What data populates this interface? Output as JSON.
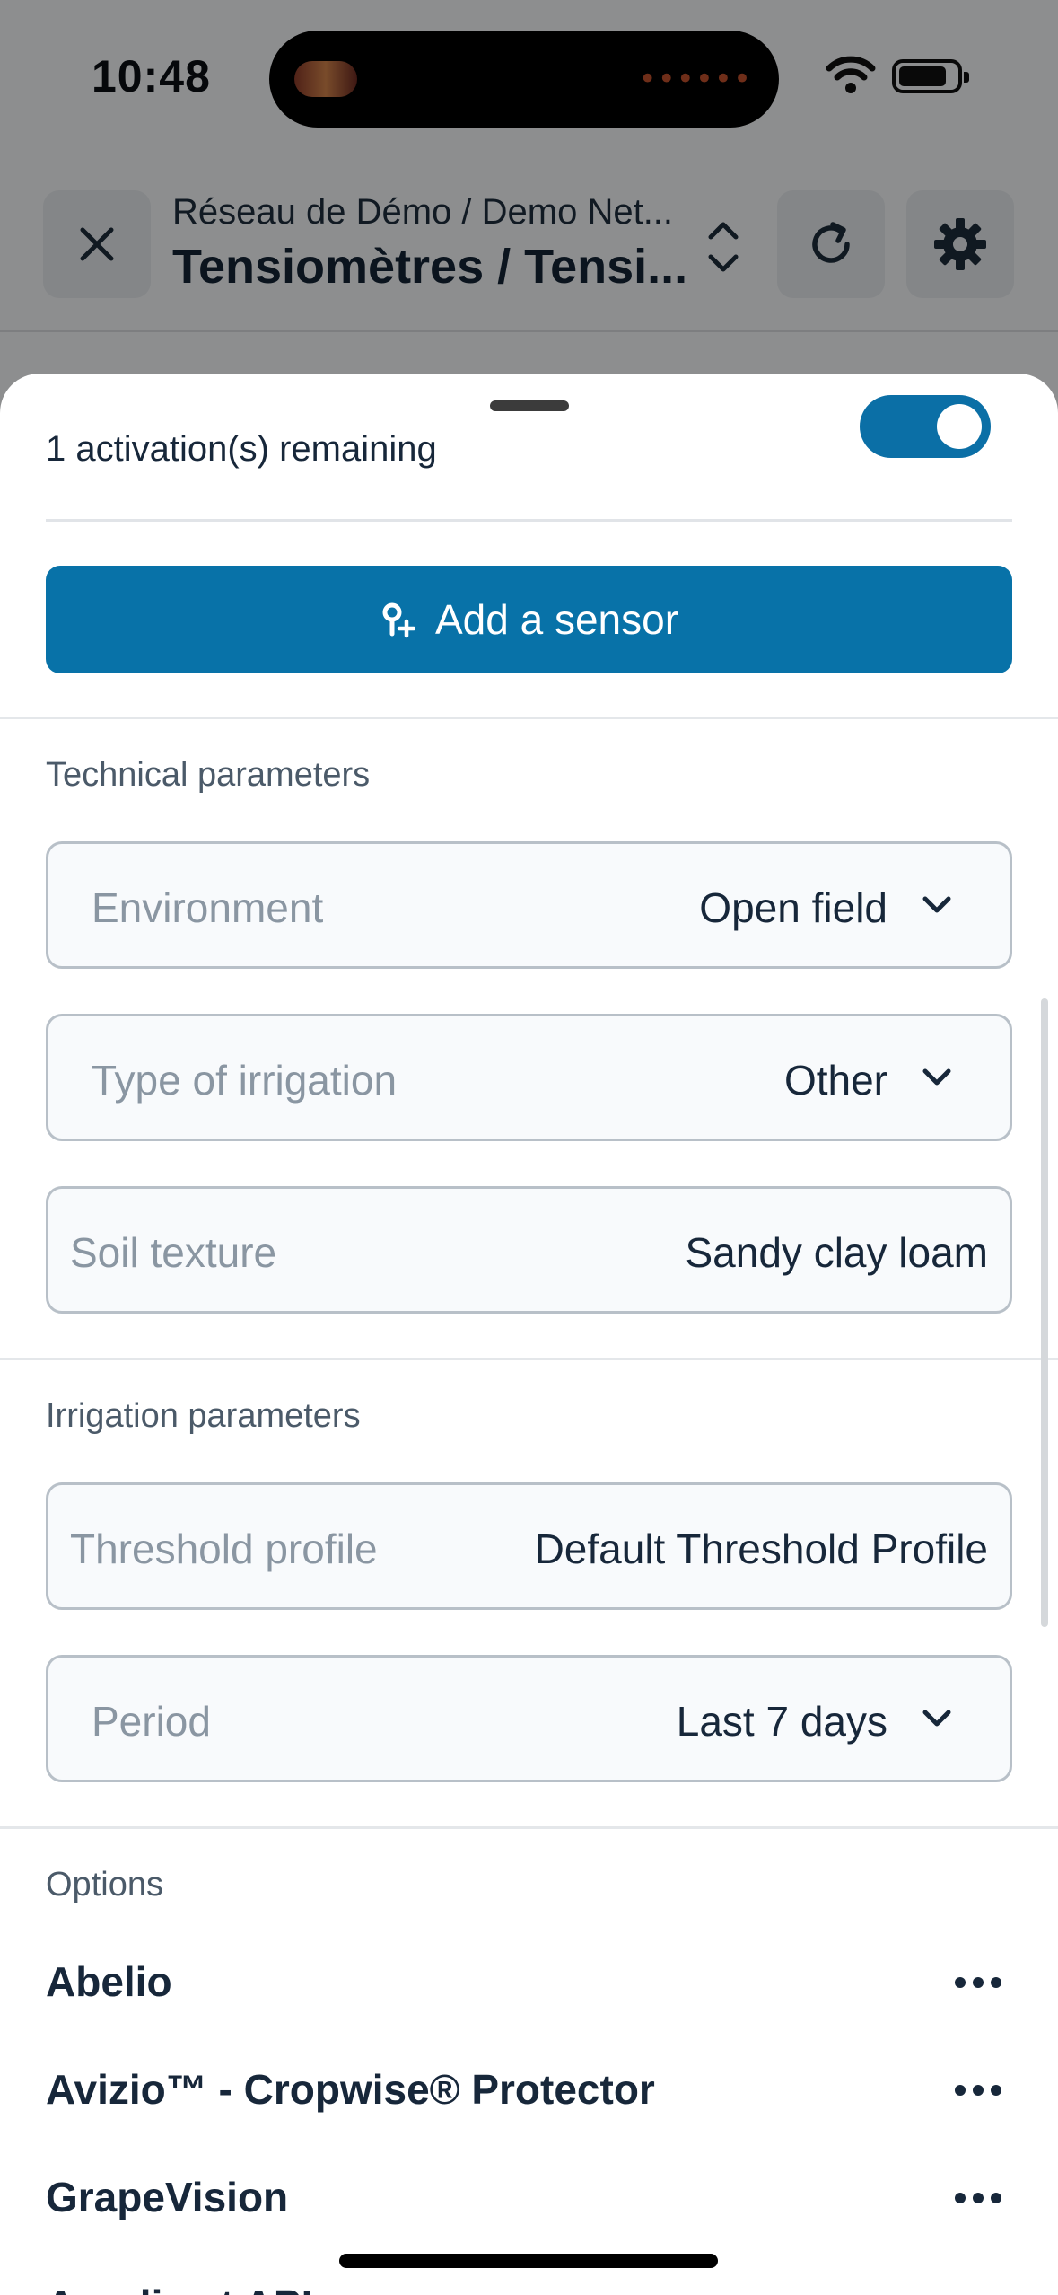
{
  "status_bar": {
    "time": "10:48",
    "island_dots": "••••••"
  },
  "header": {
    "subtitle": "Réseau de Démo / Demo Net...",
    "title": "Tensiomètres / Tensi..."
  },
  "sheet": {
    "activation_text": "1 activation(s) remaining",
    "activation_toggle_on": true,
    "add_sensor_label": "Add a sensor",
    "technical": {
      "title": "Technical parameters",
      "environment": {
        "label": "Environment",
        "value": "Open field"
      },
      "irrigation_type": {
        "label": "Type of irrigation",
        "value": "Other"
      },
      "soil_texture": {
        "label": "Soil texture",
        "value": "Sandy clay loam"
      }
    },
    "irrigation": {
      "title": "Irrigation parameters",
      "threshold_profile": {
        "label": "Threshold profile",
        "value": "Default Threshold Profile"
      },
      "period": {
        "label": "Period",
        "value": "Last 7 days"
      }
    },
    "options": {
      "title": "Options",
      "items": [
        {
          "name": "Abelio"
        },
        {
          "name": "Avizio™ - Cropwise® Protector"
        },
        {
          "name": "GrapeVision"
        },
        {
          "name": "Agralis...t API"
        }
      ]
    }
  },
  "colors": {
    "accent": "#0872a8",
    "toggle": "#0b6fa6",
    "text": "#17273a",
    "muted": "#8a96a2"
  }
}
